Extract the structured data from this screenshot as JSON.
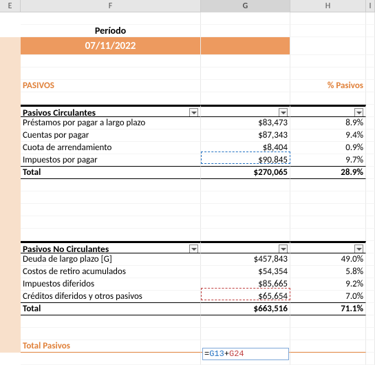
{
  "colHeaders": {
    "E": "E",
    "F": "F",
    "G": "G",
    "H": "H",
    "I": "I"
  },
  "period": {
    "label": "Período",
    "value": "07/11/2022"
  },
  "headings": {
    "pasivos": "PASIVOS",
    "pctPasivos": "% Pasivos",
    "totalPasivos": "Total Pasivos"
  },
  "circ": {
    "title": "Pasivos Circulantes",
    "rows": [
      {
        "label": "Préstamos por pagar a largo plazo",
        "val": "$83,473",
        "pct": "8.9%"
      },
      {
        "label": "Cuentas por pagar",
        "val": "$87,343",
        "pct": "9.4%"
      },
      {
        "label": "Cuota de arrendamiento",
        "val": "$8,404",
        "pct": "0.9%"
      },
      {
        "label": "Impuestos por pagar",
        "val": "$90,845",
        "pct": "9.7%"
      }
    ],
    "total": {
      "label": "Total",
      "val": "$270,065",
      "pct": "28.9%"
    }
  },
  "nocirc": {
    "title": "Pasivos No Circulantes",
    "rows": [
      {
        "label": "Deuda de largo plazo [G]",
        "val": "$457,843",
        "pct": "49.0%"
      },
      {
        "label": "Costos de retiro acumulados",
        "val": "$54,354",
        "pct": "5.8%"
      },
      {
        "label": "Impuestos diferidos",
        "val": "$85,665",
        "pct": "9.2%"
      },
      {
        "label": "Créditos diferidos y otros pasivos",
        "val": "$65,654",
        "pct": "7.0%"
      }
    ],
    "total": {
      "label": "Total",
      "val": "$663,516",
      "pct": "71.1%"
    }
  },
  "formula": {
    "eq": "=",
    "ref1": "G13",
    "plus": "+",
    "ref2": "G24"
  }
}
